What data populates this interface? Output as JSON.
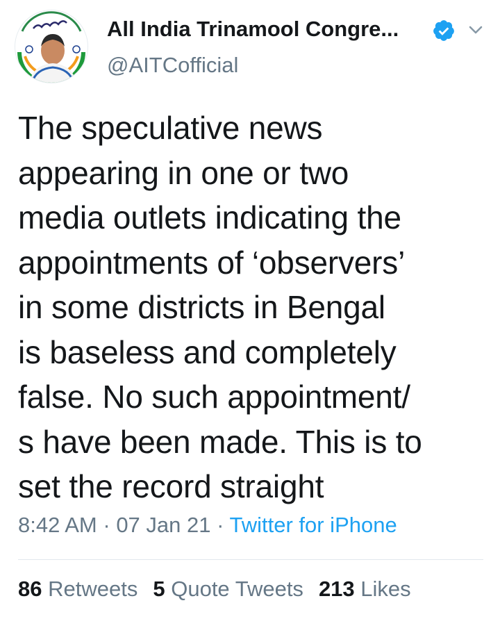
{
  "author": {
    "name": "All India Trinamool Congre...",
    "handle": "@AITCofficial",
    "verified": true,
    "avatar_icon": "profile-avatar-icon",
    "menu_icon": "chevron-down-icon"
  },
  "tweet": {
    "text": "The speculative news\nappearing in one or two\nmedia outlets indicating the\nappointments of ‘observers’\nin some districts in Bengal\nis baseless and completely\nfalse. No such appointment/\ns have been made. This is to\nset the record straight"
  },
  "meta": {
    "time": "8:42 AM",
    "separator1": " · ",
    "date": "07 Jan 21",
    "separator2": " · ",
    "source": "Twitter for iPhone"
  },
  "stats": {
    "retweets_count": "86",
    "retweets_label": "Retweets",
    "quotes_count": "5",
    "quotes_label": "Quote Tweets",
    "likes_count": "213",
    "likes_label": "Likes"
  },
  "colors": {
    "primary_text": "#14171a",
    "secondary_text": "#657786",
    "link": "#1da1f2",
    "verified_badge": "#1da1f2",
    "divider": "#e1e8ed"
  }
}
